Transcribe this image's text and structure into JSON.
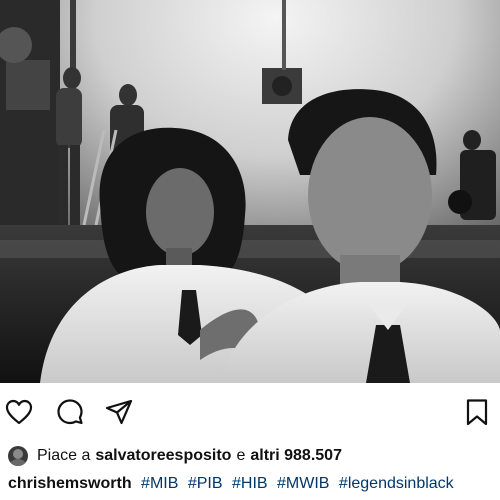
{
  "post": {
    "photo_alt": "",
    "actions": {
      "like": "heart-icon",
      "comment": "comment-icon",
      "share": "paper-plane-icon",
      "save": "bookmark-icon"
    },
    "likes": {
      "prefix": "Piace a",
      "username": "salvatoreesposito",
      "connector": "e",
      "others": "altri 988.507"
    },
    "caption": {
      "author": "chrishemsworth",
      "hashtags": [
        "#MIB",
        "#PIB",
        "#HIB",
        "#MWIB",
        "#legendsinblack"
      ]
    }
  },
  "colors": {
    "hashtag": "#00376b",
    "text": "#111111",
    "background": "#ffffff"
  }
}
